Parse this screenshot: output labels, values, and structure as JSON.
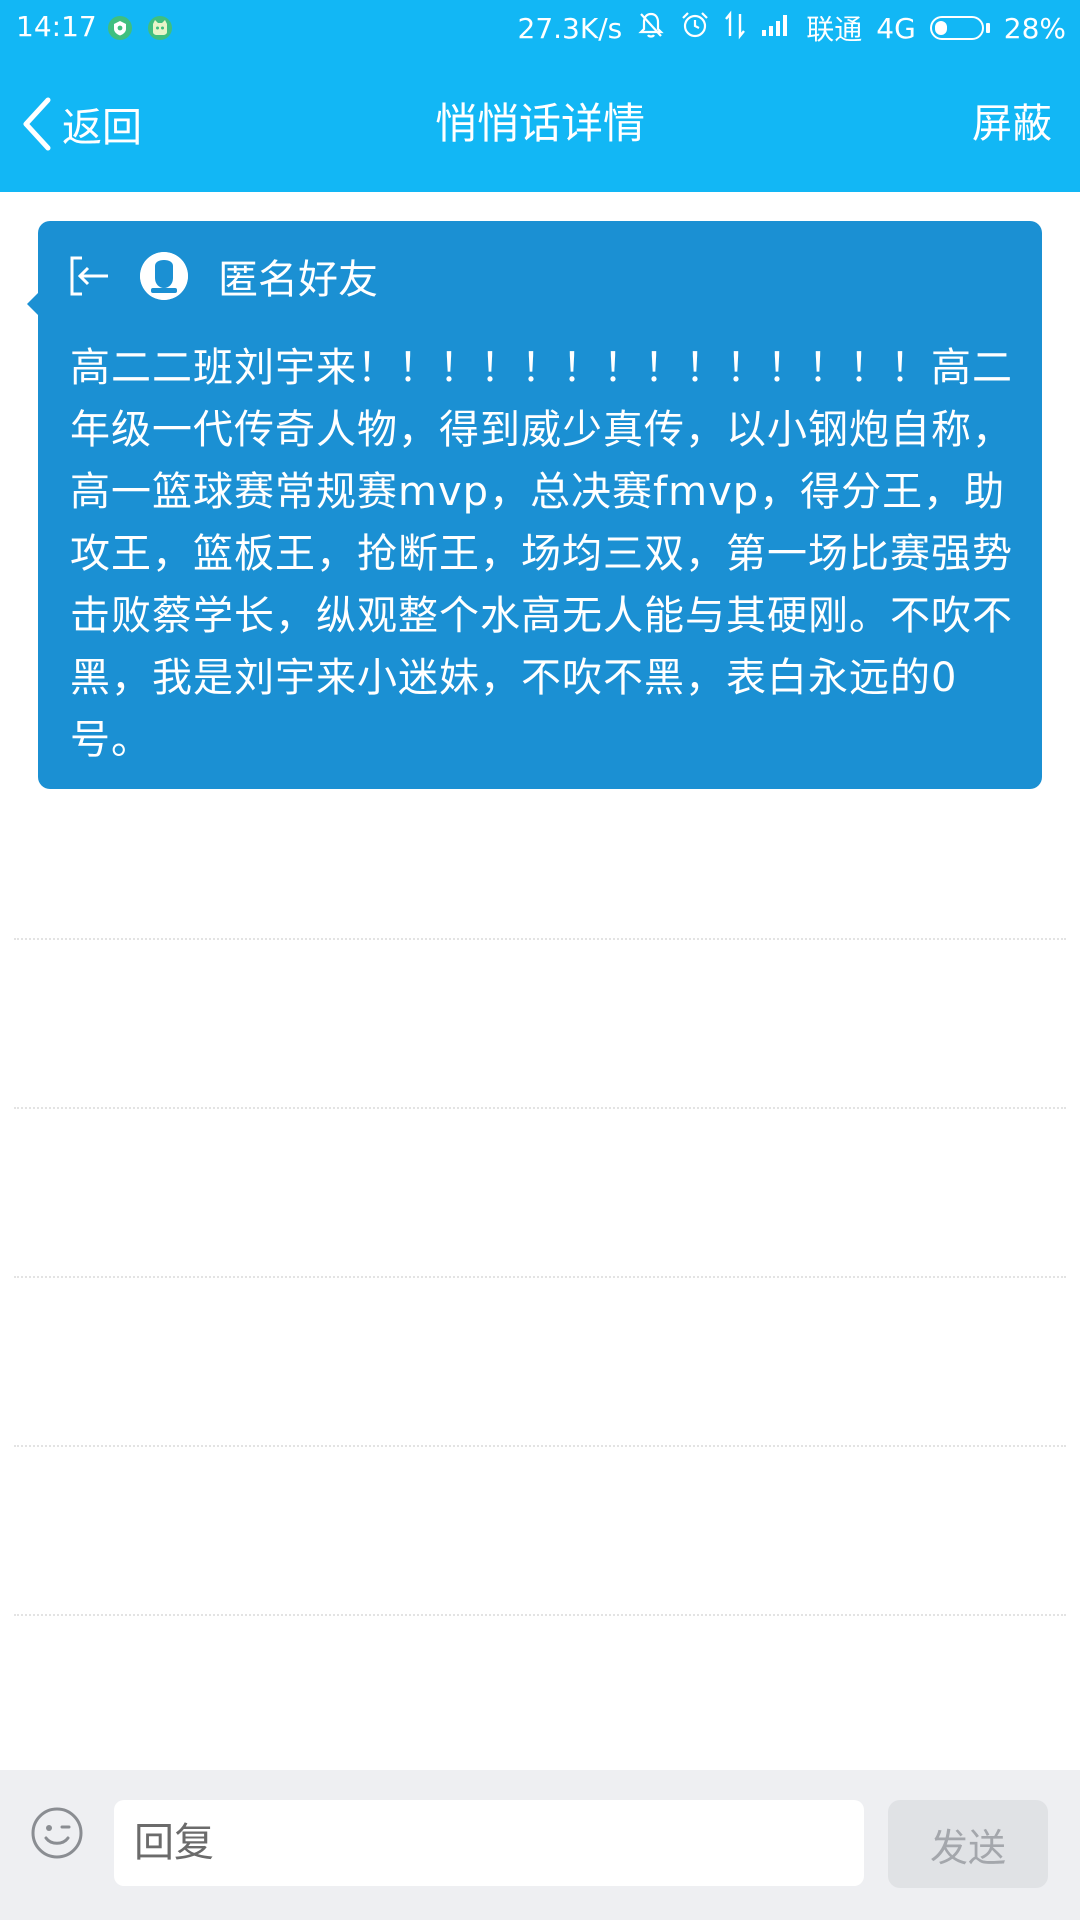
{
  "status_bar": {
    "time": "14:17",
    "net_speed": "27.3K/s",
    "carrier": "联通",
    "network": "4G",
    "battery_percent": "28%",
    "battery_level": 0.28,
    "icons": [
      "shield-icon",
      "cat-icon",
      "mute-bell-icon",
      "alarm-icon",
      "data-arrows-icon",
      "signal-icon",
      "battery-icon"
    ]
  },
  "nav": {
    "back_label": "返回",
    "title": "悄悄话详情",
    "right_label": "屏蔽"
  },
  "message": {
    "sender": "匿名好友",
    "body": "高二二班刘宇来！！！！！！！！！！！！！！高二年级一代传奇人物，得到威少真传，以小钢炮自称，高一篮球赛常规赛mvp，总决赛fmvp，得分王，助攻王，篮板王，抢断王，场均三双，第一场比赛强势击败蔡学长，纵观整个水高无人能与其硬刚。不吹不黑，我是刘宇来小迷妹，不吹不黑，表白永远的0号。",
    "card_color": "#1b90d3"
  },
  "reply_bar": {
    "placeholder": "回复",
    "send_label": "发送"
  },
  "colors": {
    "header": "#12b7f5",
    "bottom_bar": "#eeeff2"
  }
}
